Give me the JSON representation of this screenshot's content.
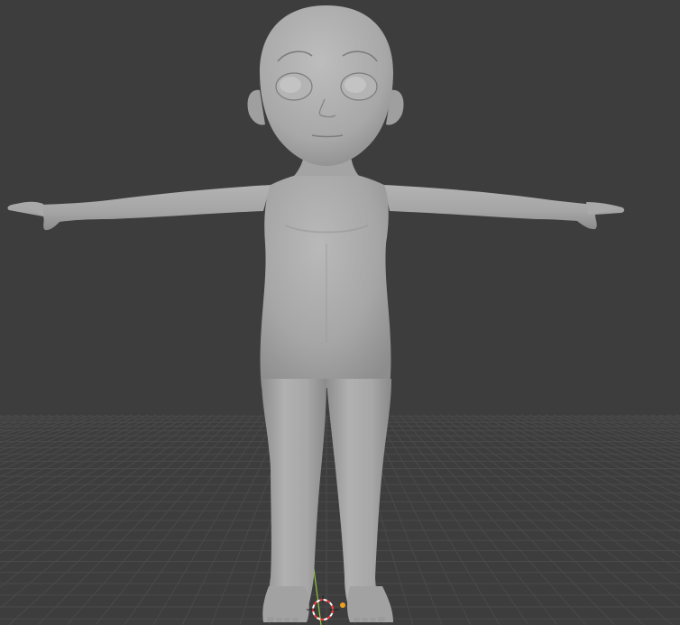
{
  "viewport": {
    "background_color": "#3d3d3d",
    "grid_color": "#4a4a4a",
    "grid_major_color": "#505050",
    "y_axis_color": "#8cc43a",
    "x_axis_color": "#c05050"
  },
  "model": {
    "body_color": "#a8a8a8",
    "shade_color": "#8e8e8e",
    "highlight_color": "#bdbdbd",
    "pose": "T-pose"
  },
  "gizmos": {
    "cursor_colors": [
      "#ff3b3b",
      "#ffffff"
    ],
    "origin_color": "#f0a020",
    "cursor_icon": "3d-cursor",
    "origin_icon": "object-origin"
  }
}
